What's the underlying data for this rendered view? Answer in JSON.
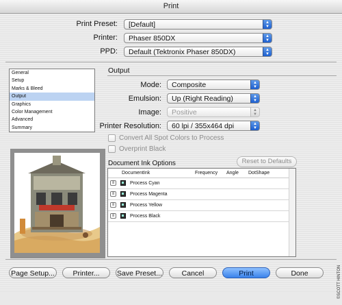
{
  "window": {
    "title": "Print"
  },
  "header": {
    "preset_label": "Print Preset:",
    "preset_value": "[Default]",
    "printer_label": "Printer:",
    "printer_value": "Phaser 850DX",
    "ppd_label": "PPD:",
    "ppd_value": "Default (Tektronix Phaser 850DX)"
  },
  "sidebar": {
    "items": [
      {
        "label": "General"
      },
      {
        "label": "Setup"
      },
      {
        "label": "Marks & Bleed"
      },
      {
        "label": "Output"
      },
      {
        "label": "Graphics"
      },
      {
        "label": "Color Management"
      },
      {
        "label": "Advanced"
      },
      {
        "label": "Summary"
      }
    ],
    "selected": "Output"
  },
  "output": {
    "section_title": "Output",
    "mode_label": "Mode:",
    "mode_value": "Composite",
    "emulsion_label": "Emulsion:",
    "emulsion_value": "Up (Right Reading)",
    "image_label": "Image:",
    "image_value": "Positive",
    "resolution_label": "Printer Resolution:",
    "resolution_value": "60 lpi / 355x464 dpi",
    "convert_spot_label": "Convert All Spot Colors to Process",
    "overprint_label": "Overprint Black"
  },
  "ink_options": {
    "title": "Document Ink Options",
    "reset_label": "Reset to Defaults",
    "columns": [
      "DocumentInk",
      "Frequency",
      "Angle",
      "DotShape"
    ],
    "rows": [
      {
        "name": "Process  Cyan"
      },
      {
        "name": "Process  Magenta"
      },
      {
        "name": "Process  Yellow"
      },
      {
        "name": "Process  Black"
      }
    ]
  },
  "buttons": {
    "page_setup": "Page Setup...",
    "printer": "Printer...",
    "save_preset": "Save Preset...",
    "cancel": "Cancel",
    "print": "Print",
    "done": "Done"
  },
  "credit": "©SCOTT HINTON",
  "colors": {
    "accent_blue": "#3a82ea",
    "selection": "#bcd3f2"
  },
  "icons": [
    "popup-arrows-icon",
    "printer-ink-icon",
    "ink-swatch-icon"
  ]
}
